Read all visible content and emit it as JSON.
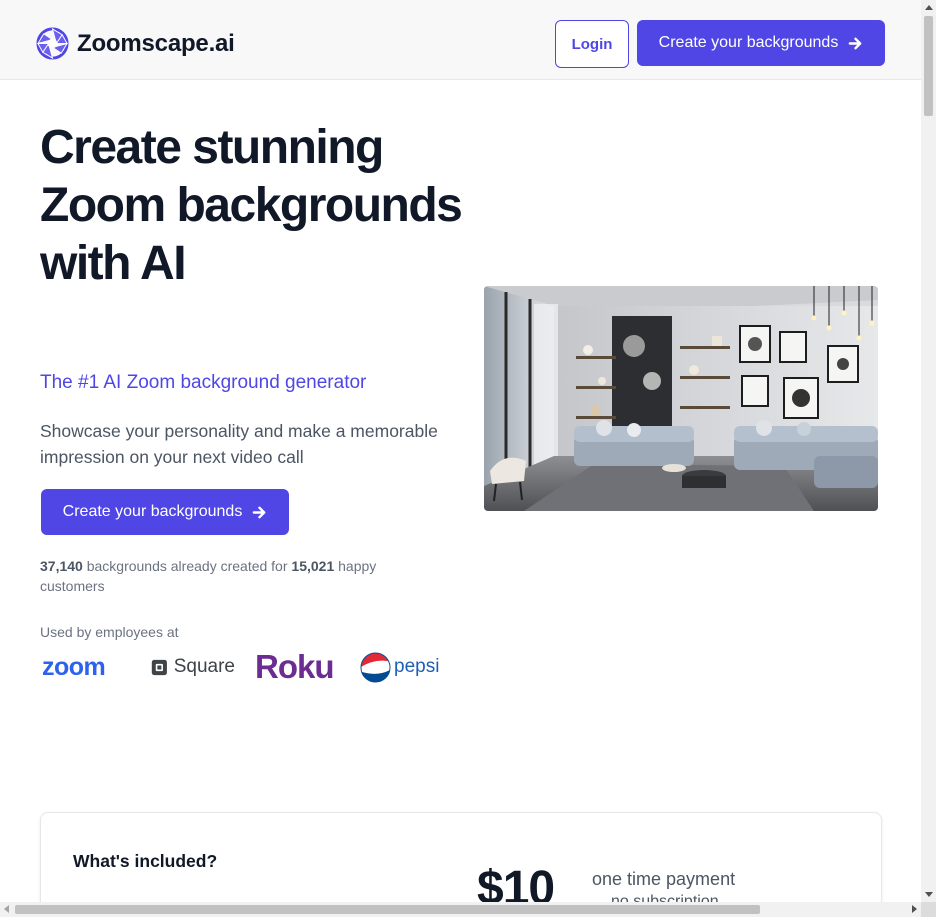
{
  "header": {
    "brand_name": "Zoomscape.ai",
    "login_label": "Login",
    "cta_label": "Create your backgrounds"
  },
  "hero": {
    "title": "Create stunning Zoom backgrounds with AI",
    "subtitle": "The #1 AI Zoom background generator",
    "description": "Showcase your personality and make a memorable impression on your next video call",
    "cta_label": "Create your backgrounds",
    "stats": {
      "backgrounds_count": "37,140",
      "backgrounds_text": " backgrounds already created for ",
      "customers_count": "15,021",
      "customers_text": " happy customers"
    },
    "used_by_label": "Used by employees at",
    "logos": [
      {
        "name": "zoom",
        "text": "zoom"
      },
      {
        "name": "square",
        "text": "Square"
      },
      {
        "name": "roku",
        "text": "Roku"
      },
      {
        "name": "pepsi",
        "text": "pepsi"
      }
    ]
  },
  "pricing": {
    "heading": "What's included?",
    "price": "$10",
    "note": "one time payment",
    "note2": "no subscription"
  },
  "colors": {
    "accent": "#4f46e5",
    "text_dark": "#111827",
    "text_muted": "#4b5563"
  },
  "icons": {
    "arrow": "arrow-right-icon",
    "brand": "aperture-logo-icon"
  }
}
